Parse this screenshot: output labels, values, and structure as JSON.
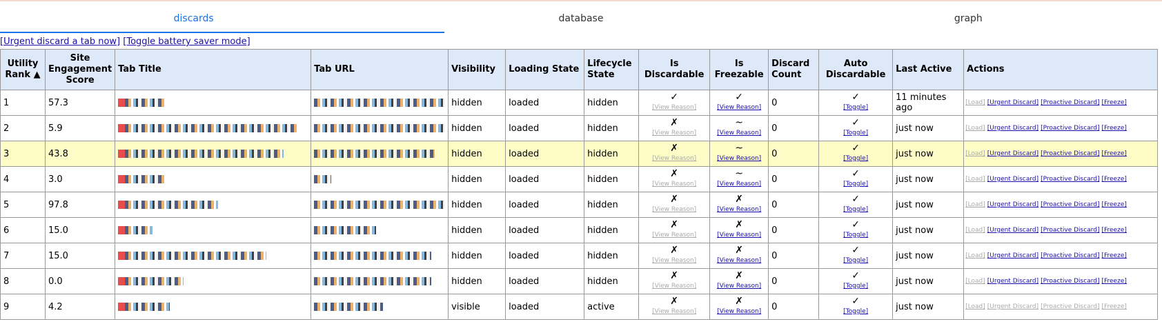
{
  "tabs": [
    "discards",
    "database",
    "graph"
  ],
  "links": [
    "[Urgent discard a tab now]",
    "[Toggle battery saver mode]"
  ],
  "headers": {
    "rank": "Utility Rank ▲",
    "score": "Site Engagement Score",
    "title": "Tab Title",
    "url": "Tab URL",
    "visibility": "Visibility",
    "loading": "Loading State",
    "lifecycle": "Lifecycle State",
    "discardable": "Is Discardable",
    "freezable": "Is Freezable",
    "count": "Discard Count",
    "auto": "Auto Discardable",
    "last": "Last Active",
    "actions": "Actions"
  },
  "labels": {
    "view_reason": "[View Reason]",
    "toggle": "[Toggle]",
    "load": "[Load]",
    "urgent": "[Urgent Discard]",
    "proactive": "[Proactive Discard]",
    "freeze": "[Freeze]"
  },
  "rows": [
    {
      "rank": "1",
      "score": "57.3",
      "visibility": "hidden",
      "loading": "loaded",
      "lifecycle": "hidden",
      "discardable": "✓",
      "freezable": "✓",
      "count": "0",
      "auto": "✓",
      "last": "11 minutes ago"
    },
    {
      "rank": "2",
      "score": "5.9",
      "visibility": "hidden",
      "loading": "loaded",
      "lifecycle": "hidden",
      "discardable": "✗",
      "freezable": "~",
      "count": "0",
      "auto": "✓",
      "last": "just now"
    },
    {
      "rank": "3",
      "score": "43.8",
      "visibility": "hidden",
      "loading": "loaded",
      "lifecycle": "hidden",
      "discardable": "✗",
      "freezable": "~",
      "count": "0",
      "auto": "✓",
      "last": "just now"
    },
    {
      "rank": "4",
      "score": "3.0",
      "visibility": "hidden",
      "loading": "loaded",
      "lifecycle": "hidden",
      "discardable": "✗",
      "freezable": "~",
      "count": "0",
      "auto": "✓",
      "last": "just now"
    },
    {
      "rank": "5",
      "score": "97.8",
      "visibility": "hidden",
      "loading": "loaded",
      "lifecycle": "hidden",
      "discardable": "✗",
      "freezable": "✗",
      "count": "0",
      "auto": "✓",
      "last": "just now"
    },
    {
      "rank": "6",
      "score": "15.0",
      "visibility": "hidden",
      "loading": "loaded",
      "lifecycle": "hidden",
      "discardable": "✗",
      "freezable": "✗",
      "count": "0",
      "auto": "✓",
      "last": "just now"
    },
    {
      "rank": "7",
      "score": "15.0",
      "visibility": "hidden",
      "loading": "loaded",
      "lifecycle": "hidden",
      "discardable": "✗",
      "freezable": "✗",
      "count": "0",
      "auto": "✓",
      "last": "just now"
    },
    {
      "rank": "8",
      "score": "0.0",
      "visibility": "hidden",
      "loading": "loaded",
      "lifecycle": "hidden",
      "discardable": "✗",
      "freezable": "✗",
      "count": "0",
      "auto": "✓",
      "last": "just now"
    },
    {
      "rank": "9",
      "score": "4.2",
      "visibility": "visible",
      "loading": "loaded",
      "lifecycle": "active",
      "discardable": "✗",
      "freezable": "✗",
      "count": "0",
      "auto": "✓",
      "last": "just now"
    }
  ]
}
